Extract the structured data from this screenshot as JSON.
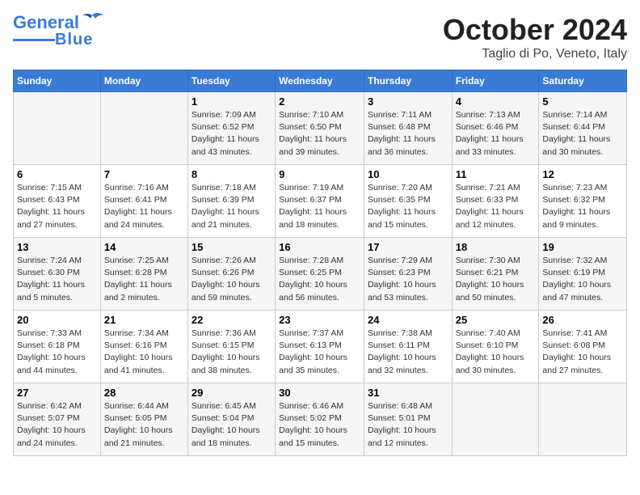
{
  "logo": {
    "line1": "General",
    "line2": "Blue"
  },
  "title": "October 2024",
  "location": "Taglio di Po, Veneto, Italy",
  "days_of_week": [
    "Sunday",
    "Monday",
    "Tuesday",
    "Wednesday",
    "Thursday",
    "Friday",
    "Saturday"
  ],
  "weeks": [
    [
      {
        "day": "",
        "info": ""
      },
      {
        "day": "",
        "info": ""
      },
      {
        "day": "1",
        "info": "Sunrise: 7:09 AM\nSunset: 6:52 PM\nDaylight: 11 hours and 43 minutes."
      },
      {
        "day": "2",
        "info": "Sunrise: 7:10 AM\nSunset: 6:50 PM\nDaylight: 11 hours and 39 minutes."
      },
      {
        "day": "3",
        "info": "Sunrise: 7:11 AM\nSunset: 6:48 PM\nDaylight: 11 hours and 36 minutes."
      },
      {
        "day": "4",
        "info": "Sunrise: 7:13 AM\nSunset: 6:46 PM\nDaylight: 11 hours and 33 minutes."
      },
      {
        "day": "5",
        "info": "Sunrise: 7:14 AM\nSunset: 6:44 PM\nDaylight: 11 hours and 30 minutes."
      }
    ],
    [
      {
        "day": "6",
        "info": "Sunrise: 7:15 AM\nSunset: 6:43 PM\nDaylight: 11 hours and 27 minutes."
      },
      {
        "day": "7",
        "info": "Sunrise: 7:16 AM\nSunset: 6:41 PM\nDaylight: 11 hours and 24 minutes."
      },
      {
        "day": "8",
        "info": "Sunrise: 7:18 AM\nSunset: 6:39 PM\nDaylight: 11 hours and 21 minutes."
      },
      {
        "day": "9",
        "info": "Sunrise: 7:19 AM\nSunset: 6:37 PM\nDaylight: 11 hours and 18 minutes."
      },
      {
        "day": "10",
        "info": "Sunrise: 7:20 AM\nSunset: 6:35 PM\nDaylight: 11 hours and 15 minutes."
      },
      {
        "day": "11",
        "info": "Sunrise: 7:21 AM\nSunset: 6:33 PM\nDaylight: 11 hours and 12 minutes."
      },
      {
        "day": "12",
        "info": "Sunrise: 7:23 AM\nSunset: 6:32 PM\nDaylight: 11 hours and 9 minutes."
      }
    ],
    [
      {
        "day": "13",
        "info": "Sunrise: 7:24 AM\nSunset: 6:30 PM\nDaylight: 11 hours and 5 minutes."
      },
      {
        "day": "14",
        "info": "Sunrise: 7:25 AM\nSunset: 6:28 PM\nDaylight: 11 hours and 2 minutes."
      },
      {
        "day": "15",
        "info": "Sunrise: 7:26 AM\nSunset: 6:26 PM\nDaylight: 10 hours and 59 minutes."
      },
      {
        "day": "16",
        "info": "Sunrise: 7:28 AM\nSunset: 6:25 PM\nDaylight: 10 hours and 56 minutes."
      },
      {
        "day": "17",
        "info": "Sunrise: 7:29 AM\nSunset: 6:23 PM\nDaylight: 10 hours and 53 minutes."
      },
      {
        "day": "18",
        "info": "Sunrise: 7:30 AM\nSunset: 6:21 PM\nDaylight: 10 hours and 50 minutes."
      },
      {
        "day": "19",
        "info": "Sunrise: 7:32 AM\nSunset: 6:19 PM\nDaylight: 10 hours and 47 minutes."
      }
    ],
    [
      {
        "day": "20",
        "info": "Sunrise: 7:33 AM\nSunset: 6:18 PM\nDaylight: 10 hours and 44 minutes."
      },
      {
        "day": "21",
        "info": "Sunrise: 7:34 AM\nSunset: 6:16 PM\nDaylight: 10 hours and 41 minutes."
      },
      {
        "day": "22",
        "info": "Sunrise: 7:36 AM\nSunset: 6:15 PM\nDaylight: 10 hours and 38 minutes."
      },
      {
        "day": "23",
        "info": "Sunrise: 7:37 AM\nSunset: 6:13 PM\nDaylight: 10 hours and 35 minutes."
      },
      {
        "day": "24",
        "info": "Sunrise: 7:38 AM\nSunset: 6:11 PM\nDaylight: 10 hours and 32 minutes."
      },
      {
        "day": "25",
        "info": "Sunrise: 7:40 AM\nSunset: 6:10 PM\nDaylight: 10 hours and 30 minutes."
      },
      {
        "day": "26",
        "info": "Sunrise: 7:41 AM\nSunset: 6:08 PM\nDaylight: 10 hours and 27 minutes."
      }
    ],
    [
      {
        "day": "27",
        "info": "Sunrise: 6:42 AM\nSunset: 5:07 PM\nDaylight: 10 hours and 24 minutes."
      },
      {
        "day": "28",
        "info": "Sunrise: 6:44 AM\nSunset: 5:05 PM\nDaylight: 10 hours and 21 minutes."
      },
      {
        "day": "29",
        "info": "Sunrise: 6:45 AM\nSunset: 5:04 PM\nDaylight: 10 hours and 18 minutes."
      },
      {
        "day": "30",
        "info": "Sunrise: 6:46 AM\nSunset: 5:02 PM\nDaylight: 10 hours and 15 minutes."
      },
      {
        "day": "31",
        "info": "Sunrise: 6:48 AM\nSunset: 5:01 PM\nDaylight: 10 hours and 12 minutes."
      },
      {
        "day": "",
        "info": ""
      },
      {
        "day": "",
        "info": ""
      }
    ]
  ]
}
